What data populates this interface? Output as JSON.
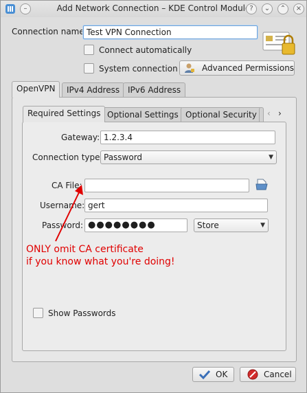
{
  "window": {
    "title": "Add Network Connection – KDE Control Module"
  },
  "form": {
    "connection_name_label": "Connection name:",
    "connection_name_value": "Test VPN Connection",
    "connect_automatically_label": "Connect automatically",
    "system_connection_label": "System connection",
    "advanced_permissions_label": "Advanced Permissions"
  },
  "tabs": [
    "OpenVPN",
    "IPv4 Address",
    "IPv6 Address"
  ],
  "subtabs": [
    "Required Settings",
    "Optional Settings",
    "Optional Security"
  ],
  "required": {
    "gateway_label": "Gateway:",
    "gateway_value": "1.2.3.4",
    "connection_type_label": "Connection type:",
    "connection_type_value": "Password",
    "ca_file_label": "CA File:",
    "ca_file_value": "",
    "username_label": "Username:",
    "username_value": "gert",
    "password_label": "Password:",
    "password_value": "●●●●●●●●",
    "password_store_value": "Store",
    "show_passwords_label": "Show Passwords"
  },
  "annotation": {
    "line1": "ONLY omit CA certificate",
    "line2": "if you know what you're doing!",
    "color": "#e00000"
  },
  "buttons": {
    "ok_label": "OK",
    "cancel_label": "Cancel"
  },
  "icons": {
    "app": "network-app-icon",
    "help": "help-icon",
    "minimize": "minimize-icon",
    "maximize": "maximize-icon",
    "close": "close-icon",
    "permissions": "vpn-certificate-lock-icon",
    "file_open": "file-open-icon",
    "user": "user-icon",
    "ok": "checkmark-icon",
    "cancel": "cancel-icon"
  }
}
